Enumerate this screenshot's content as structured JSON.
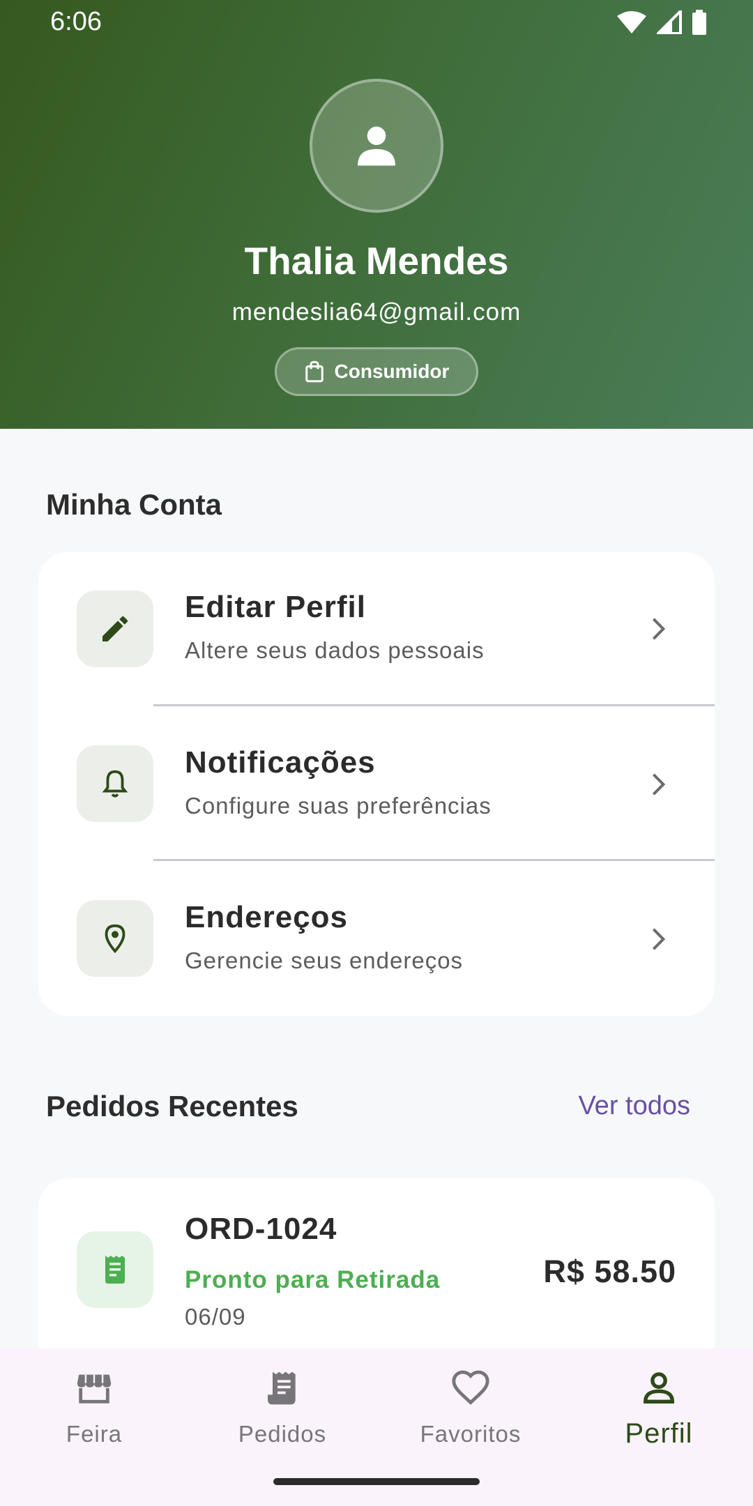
{
  "status_bar": {
    "time": "6:06"
  },
  "profile": {
    "name": "Thalia Mendes",
    "email": "mendeslia64@gmail.com",
    "role": "Consumidor"
  },
  "account": {
    "title": "Minha Conta",
    "items": [
      {
        "title": "Editar Perfil",
        "subtitle": "Altere seus dados pessoais",
        "icon": "pencil-icon"
      },
      {
        "title": "Notificações",
        "subtitle": "Configure suas preferências",
        "icon": "bell-icon"
      },
      {
        "title": "Endereços",
        "subtitle": "Gerencie seus endereços",
        "icon": "location-pin-icon"
      }
    ]
  },
  "orders": {
    "title": "Pedidos Recentes",
    "see_all": "Ver todos",
    "items": [
      {
        "id": "ORD-1024",
        "status": "Pronto para Retirada",
        "date": "06/09",
        "total": "R$ 58.50",
        "icon": "receipt-icon"
      }
    ]
  },
  "nav": {
    "active": "Perfil",
    "items": [
      {
        "label": "Feira",
        "icon": "store-icon"
      },
      {
        "label": "Pedidos",
        "icon": "receipt-icon"
      },
      {
        "label": "Favoritos",
        "icon": "heart-icon"
      },
      {
        "label": "Perfil",
        "icon": "person-icon"
      }
    ]
  },
  "colors": {
    "header_start": "#35591f",
    "header_end": "#4a7d58",
    "accent_green": "#3d5a22",
    "status_green": "#4caf50",
    "link_purple": "#6750a4",
    "nav_background": "#fbf3fb"
  }
}
